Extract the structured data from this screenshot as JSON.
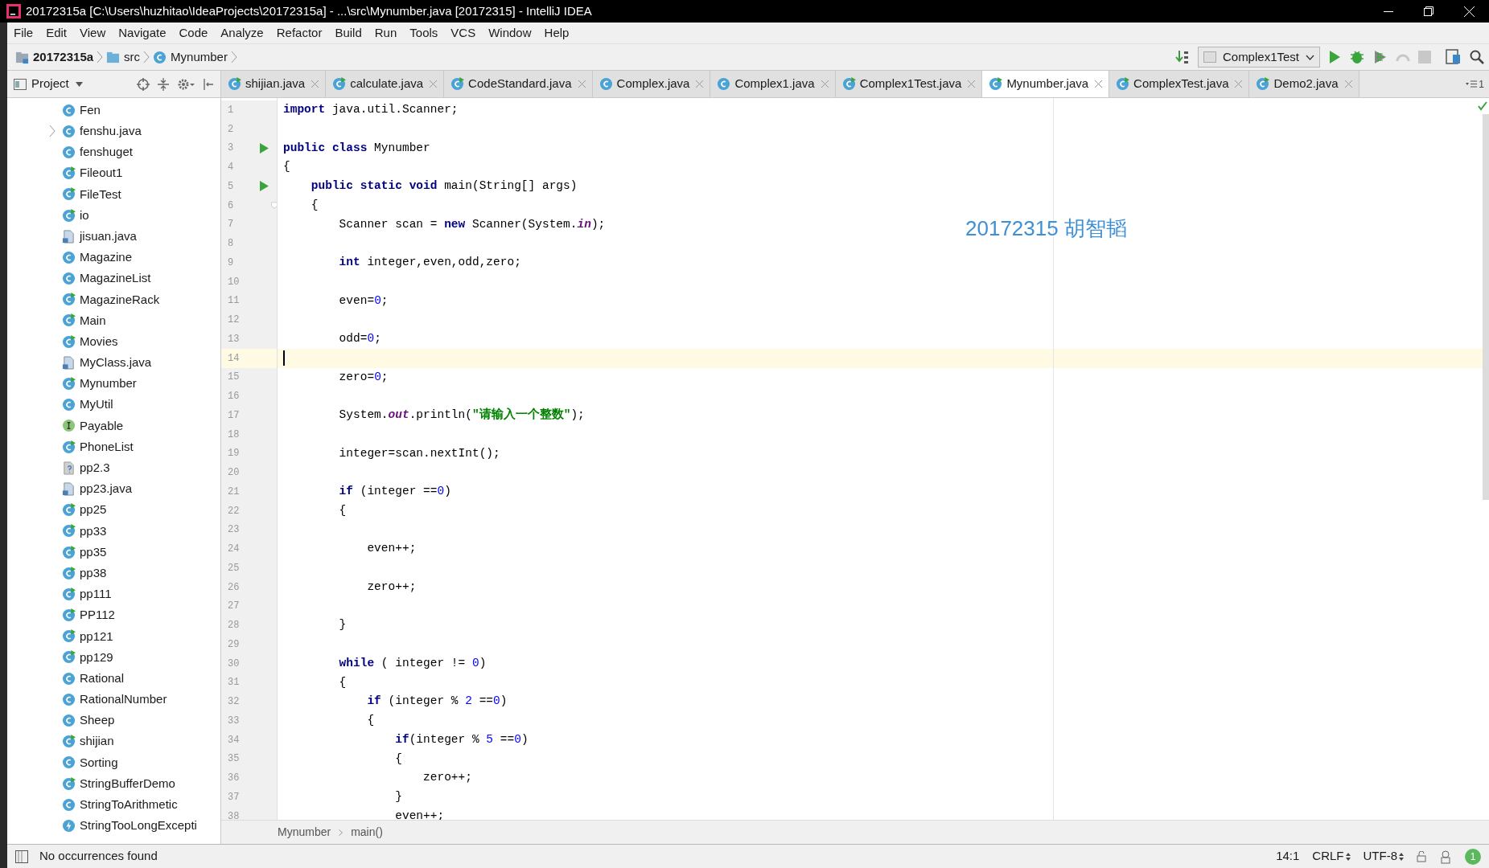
{
  "window": {
    "title": "20172315a [C:\\Users\\huzhitao\\IdeaProjects\\20172315a] - ...\\src\\Mynumber.java [20172315] - IntelliJ IDEA"
  },
  "menu": [
    "File",
    "Edit",
    "View",
    "Navigate",
    "Code",
    "Analyze",
    "Refactor",
    "Build",
    "Run",
    "Tools",
    "VCS",
    "Window",
    "Help"
  ],
  "nav_bar": {
    "crumbs": [
      {
        "kind": "module",
        "text": "20172315a"
      },
      {
        "kind": "folder",
        "text": "src"
      },
      {
        "kind": "class",
        "text": "Mynumber"
      }
    ],
    "run_config": "Complex1Test"
  },
  "project_panel": {
    "title": "Project",
    "items": [
      {
        "kind": "class",
        "name": "Fen",
        "expandable": false
      },
      {
        "kind": "class",
        "name": "fenshu.java",
        "expandable": true
      },
      {
        "kind": "class",
        "name": "fenshuget",
        "expandable": false
      },
      {
        "kind": "runnable",
        "name": "Fileout1",
        "expandable": false
      },
      {
        "kind": "runnable",
        "name": "FileTest",
        "expandable": false
      },
      {
        "kind": "runnable",
        "name": "io",
        "expandable": false
      },
      {
        "kind": "javafile",
        "name": "jisuan.java",
        "expandable": false
      },
      {
        "kind": "class",
        "name": "Magazine",
        "expandable": false
      },
      {
        "kind": "class",
        "name": "MagazineList",
        "expandable": false
      },
      {
        "kind": "runnable",
        "name": "MagazineRack",
        "expandable": false
      },
      {
        "kind": "runnable",
        "name": "Main",
        "expandable": false
      },
      {
        "kind": "runnable",
        "name": "Movies",
        "expandable": false
      },
      {
        "kind": "javafile",
        "name": "MyClass.java",
        "expandable": false
      },
      {
        "kind": "runnable",
        "name": "Mynumber",
        "expandable": false
      },
      {
        "kind": "class",
        "name": "MyUtil",
        "expandable": false
      },
      {
        "kind": "interface",
        "name": "Payable",
        "expandable": false
      },
      {
        "kind": "runnable",
        "name": "PhoneList",
        "expandable": false
      },
      {
        "kind": "unknown",
        "name": "pp2.3",
        "expandable": false
      },
      {
        "kind": "javafile",
        "name": "pp23.java",
        "expandable": false
      },
      {
        "kind": "runnable",
        "name": "pp25",
        "expandable": false
      },
      {
        "kind": "runnable",
        "name": "pp33",
        "expandable": false
      },
      {
        "kind": "runnable",
        "name": "pp35",
        "expandable": false
      },
      {
        "kind": "runnable",
        "name": "pp38",
        "expandable": false
      },
      {
        "kind": "runnable",
        "name": "pp111",
        "expandable": false
      },
      {
        "kind": "runnable",
        "name": "PP112",
        "expandable": false
      },
      {
        "kind": "runnable",
        "name": "pp121",
        "expandable": false
      },
      {
        "kind": "runnable",
        "name": "pp129",
        "expandable": false
      },
      {
        "kind": "class",
        "name": "Rational",
        "expandable": false
      },
      {
        "kind": "class",
        "name": "RationalNumber",
        "expandable": false
      },
      {
        "kind": "class",
        "name": "Sheep",
        "expandable": false
      },
      {
        "kind": "runnable",
        "name": "shijian",
        "expandable": false
      },
      {
        "kind": "class",
        "name": "Sorting",
        "expandable": false
      },
      {
        "kind": "runnable",
        "name": "StringBufferDemo",
        "expandable": false
      },
      {
        "kind": "class",
        "name": "StringToArithmetic",
        "expandable": false
      },
      {
        "kind": "exception",
        "name": "StringTooLongExcepti",
        "expandable": false
      }
    ]
  },
  "tabs": [
    {
      "kind": "runnable",
      "label": "shijian.java",
      "selected": false
    },
    {
      "kind": "runnable",
      "label": "calculate.java",
      "selected": false
    },
    {
      "kind": "runnable",
      "label": "CodeStandard.java",
      "selected": false
    },
    {
      "kind": "class",
      "label": "Complex.java",
      "selected": false
    },
    {
      "kind": "class",
      "label": "Complex1.java",
      "selected": false
    },
    {
      "kind": "runnable",
      "label": "Complex1Test.java",
      "selected": false
    },
    {
      "kind": "runnable",
      "label": "Mynumber.java",
      "selected": true
    },
    {
      "kind": "runnable",
      "label": "ComplexTest.java",
      "selected": false
    },
    {
      "kind": "runnable",
      "label": "Demo2.java",
      "selected": false
    }
  ],
  "tab_overflow": "1",
  "editor": {
    "annotation": "20172315 胡智韬",
    "lines": [
      {
        "number": "1",
        "current": false,
        "tokens": [
          {
            "kind": "keyword",
            "text": "import"
          },
          {
            "kind": "plain",
            "text": " java.util.Scanner;"
          }
        ]
      },
      {
        "number": "2",
        "current": false
      },
      {
        "number": "3",
        "current": false,
        "gutter_icon": {
          "kind": "run"
        },
        "tokens": [
          {
            "kind": "keyword",
            "text": "public class"
          },
          {
            "kind": "plain",
            "text": " Mynumber"
          }
        ]
      },
      {
        "number": "4",
        "current": false,
        "tokens": [
          {
            "kind": "plain",
            "text": "{"
          }
        ]
      },
      {
        "number": "5",
        "current": false,
        "gutter_icon": {
          "kind": "run"
        },
        "tokens": [
          {
            "kind": "keyword",
            "text": "    public static void"
          },
          {
            "kind": "plain",
            "text": " main(String[] args)"
          }
        ]
      },
      {
        "number": "6",
        "current": false,
        "gutter_icon": {
          "kind": "fold"
        },
        "tokens": [
          {
            "kind": "plain",
            "text": "    {"
          }
        ]
      },
      {
        "number": "7",
        "current": false,
        "tokens": [
          {
            "kind": "plain",
            "text": "        Scanner scan = "
          },
          {
            "kind": "keyword",
            "text": "new"
          },
          {
            "kind": "plain",
            "text": " Scanner(System."
          },
          {
            "kind": "static",
            "text": "in"
          },
          {
            "kind": "plain",
            "text": ");"
          }
        ]
      },
      {
        "number": "8",
        "current": false
      },
      {
        "number": "9",
        "current": false,
        "tokens": [
          {
            "kind": "keyword",
            "text": "        int"
          },
          {
            "kind": "plain",
            "text": " integer,even,odd,zero;"
          }
        ]
      },
      {
        "number": "10",
        "current": false
      },
      {
        "number": "11",
        "current": false,
        "tokens": [
          {
            "kind": "plain",
            "text": "        even="
          },
          {
            "kind": "number",
            "text": "0"
          },
          {
            "kind": "plain",
            "text": ";"
          }
        ]
      },
      {
        "number": "12",
        "current": false
      },
      {
        "number": "13",
        "current": false,
        "tokens": [
          {
            "kind": "plain",
            "text": "        odd="
          },
          {
            "kind": "number",
            "text": "0"
          },
          {
            "kind": "plain",
            "text": ";"
          }
        ]
      },
      {
        "number": "14",
        "current": true
      },
      {
        "number": "15",
        "current": false,
        "tokens": [
          {
            "kind": "plain",
            "text": "        zero="
          },
          {
            "kind": "number",
            "text": "0"
          },
          {
            "kind": "plain",
            "text": ";"
          }
        ]
      },
      {
        "number": "16",
        "current": false
      },
      {
        "number": "17",
        "current": false,
        "tokens": [
          {
            "kind": "plain",
            "text": "        System."
          },
          {
            "kind": "static",
            "text": "out"
          },
          {
            "kind": "plain",
            "text": ".println("
          },
          {
            "kind": "string",
            "text": "\"请输入一个整数\""
          },
          {
            "kind": "plain",
            "text": ");"
          }
        ]
      },
      {
        "number": "18",
        "current": false
      },
      {
        "number": "19",
        "current": false,
        "tokens": [
          {
            "kind": "plain",
            "text": "        integer=scan.nextInt();"
          }
        ]
      },
      {
        "number": "20",
        "current": false
      },
      {
        "number": "21",
        "current": false,
        "tokens": [
          {
            "kind": "keyword",
            "text": "        if"
          },
          {
            "kind": "plain",
            "text": " (integer =="
          },
          {
            "kind": "number",
            "text": "0"
          },
          {
            "kind": "plain",
            "text": ")"
          }
        ]
      },
      {
        "number": "22",
        "current": false,
        "tokens": [
          {
            "kind": "plain",
            "text": "        {"
          }
        ]
      },
      {
        "number": "23",
        "current": false
      },
      {
        "number": "24",
        "current": false,
        "tokens": [
          {
            "kind": "plain",
            "text": "            even++;"
          }
        ]
      },
      {
        "number": "25",
        "current": false
      },
      {
        "number": "26",
        "current": false,
        "tokens": [
          {
            "kind": "plain",
            "text": "            zero++;"
          }
        ]
      },
      {
        "number": "27",
        "current": false
      },
      {
        "number": "28",
        "current": false,
        "tokens": [
          {
            "kind": "plain",
            "text": "        }"
          }
        ]
      },
      {
        "number": "29",
        "current": false
      },
      {
        "number": "30",
        "current": false,
        "tokens": [
          {
            "kind": "keyword",
            "text": "        while"
          },
          {
            "kind": "plain",
            "text": " ( integer != "
          },
          {
            "kind": "number",
            "text": "0"
          },
          {
            "kind": "plain",
            "text": ")"
          }
        ]
      },
      {
        "number": "31",
        "current": false,
        "tokens": [
          {
            "kind": "plain",
            "text": "        {"
          }
        ]
      },
      {
        "number": "32",
        "current": false,
        "tokens": [
          {
            "kind": "keyword",
            "text": "            if"
          },
          {
            "kind": "plain",
            "text": " (integer % "
          },
          {
            "kind": "number",
            "text": "2"
          },
          {
            "kind": "plain",
            "text": " =="
          },
          {
            "kind": "number",
            "text": "0"
          },
          {
            "kind": "plain",
            "text": ")"
          }
        ]
      },
      {
        "number": "33",
        "current": false,
        "tokens": [
          {
            "kind": "plain",
            "text": "            {"
          }
        ]
      },
      {
        "number": "34",
        "current": false,
        "tokens": [
          {
            "kind": "keyword",
            "text": "                if"
          },
          {
            "kind": "plain",
            "text": "(integer % "
          },
          {
            "kind": "number",
            "text": "5"
          },
          {
            "kind": "plain",
            "text": " =="
          },
          {
            "kind": "number",
            "text": "0"
          },
          {
            "kind": "plain",
            "text": ")"
          }
        ]
      },
      {
        "number": "35",
        "current": false,
        "tokens": [
          {
            "kind": "plain",
            "text": "                {"
          }
        ]
      },
      {
        "number": "36",
        "current": false,
        "tokens": [
          {
            "kind": "plain",
            "text": "                    zero++;"
          }
        ]
      },
      {
        "number": "37",
        "current": false,
        "tokens": [
          {
            "kind": "plain",
            "text": "                }"
          }
        ]
      },
      {
        "number": "38",
        "current": false,
        "tokens": [
          {
            "kind": "plain",
            "text": "                even++;"
          }
        ]
      }
    ]
  },
  "breadcrumb": [
    "Mynumber",
    "main()"
  ],
  "status_bar": {
    "message": "No occurrences found",
    "position": "14:1",
    "line_separator": "CRLF",
    "encoding": "UTF-8",
    "notifications": "1"
  }
}
